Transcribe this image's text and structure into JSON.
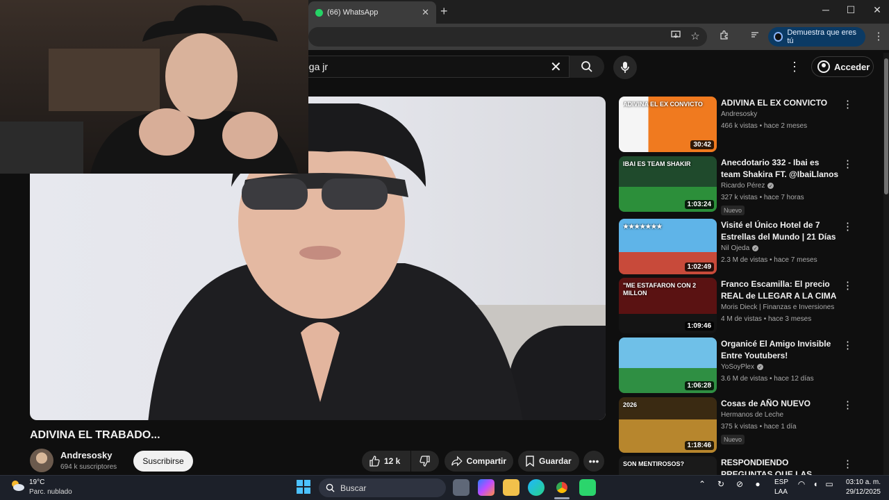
{
  "browser": {
    "tab_title": "(66) WhatsApp",
    "new_tab": "+",
    "profile_label": "Demuestra que eres tú",
    "win_min": "─",
    "win_max": "☐",
    "win_close": "✕"
  },
  "youtube": {
    "search_value": "ega jr",
    "sign_in": "Acceder",
    "video": {
      "title": "ADIVINA EL TRABADO...",
      "channel": "Andresosky",
      "subscribers": "694 k suscriptores",
      "subscribe_label": "Suscribirse",
      "likes": "12 k",
      "share_label": "Compartir",
      "save_label": "Guardar",
      "more_label": "•••"
    },
    "recommendations": [
      {
        "title": "ADIVINA EL EX CONVICTO",
        "channel": "Andresosky",
        "verified": false,
        "meta": "466 k vistas • hace 2 meses",
        "duration": "30:42",
        "badge": "",
        "thumb_text": "ADIVINA EL EX CONVICTO"
      },
      {
        "title": "Anecdotario 332 - Ibai es team Shakira FT. @IbaiLlanos",
        "channel": "Ricardo Pérez",
        "verified": true,
        "meta": "327 k vistas • hace 7 horas",
        "duration": "1:03:24",
        "badge": "Nuevo",
        "thumb_text": "IBAI ES TEAM SHAKIR"
      },
      {
        "title": "Visité el Único Hotel de 7 Estrellas del Mundo | 21 Días ...",
        "channel": "Nil Ojeda",
        "verified": true,
        "meta": "2.3 M de vistas • hace 7 meses",
        "duration": "1:02:49",
        "badge": "",
        "thumb_text": "★★★★★★★"
      },
      {
        "title": "Franco Escamilla: El precio REAL de LLEGAR A LA CIMA | ...",
        "channel": "Moris Dieck | Finanzas e Inversiones",
        "verified": false,
        "meta": "4 M de vistas • hace 3 meses",
        "duration": "1:09:46",
        "badge": "",
        "thumb_text": "\"ME ESTAFARON CON 2 MILLON"
      },
      {
        "title": "Organicé El Amigo Invisible Entre Youtubers!",
        "channel": "YoSoyPlex",
        "verified": true,
        "meta": "3.6 M de vistas • hace 12 días",
        "duration": "1:06:28",
        "badge": "",
        "thumb_text": ""
      },
      {
        "title": "Cosas de AÑO NUEVO",
        "channel": "Hermanos de Leche",
        "verified": false,
        "meta": "375 k vistas • hace 1 día",
        "duration": "1:18:46",
        "badge": "Nuevo",
        "thumb_text": "2026"
      },
      {
        "title": "RESPONDIENDO PREGUNTAS QUE LAS MUJERES QUIEREN",
        "channel": "",
        "verified": false,
        "meta": "",
        "duration": "",
        "badge": "",
        "thumb_text": "SON MENTIROSOS?"
      }
    ]
  },
  "taskbar": {
    "temperature": "19°C",
    "weather": "Parc. nublado",
    "search_placeholder": "Buscar",
    "lang_top": "ESP",
    "lang_bottom": "LAA",
    "time": "03:10 a. m.",
    "date": "29/12/2025"
  },
  "colors": {
    "yt_bg": "#0f0f0f",
    "accent_profile": "#0b3a64",
    "whatsapp": "#25d366",
    "taskbar": "#1c2029"
  }
}
